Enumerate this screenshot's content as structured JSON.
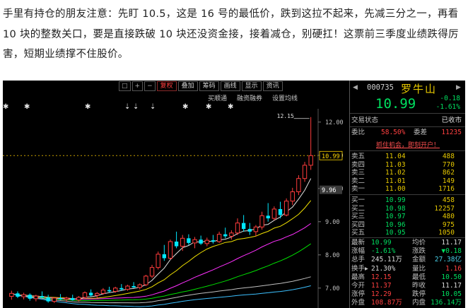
{
  "article": {
    "paragraph": "手里有持仓的朋友注意：先盯 10.5，这是 16 号的最低价，跌到这拉不起来，先减三分之一，再看 10 块的整数关口，要是直接跌破 10 块还没资金接，接着减仓，别硬扛！这票前三季度业绩跌得厉害，短期业绩撑不住股价。"
  },
  "toolbar": {
    "items": [
      "□",
      "+",
      "−",
      "复权",
      "叠加",
      "筹码",
      "画线",
      "显示",
      "资讯"
    ],
    "active_label": "复权",
    "sub_items": [
      "买顺通",
      "融资融券",
      "设置均线"
    ]
  },
  "chart_data": {
    "type": "candlestick",
    "y_axis": {
      "min": 6.4,
      "max": 12.4,
      "tick_labels": [
        "12.00",
        "11.00",
        "10.00",
        "9.00",
        "8.00",
        "7.00"
      ],
      "tick_values": [
        12,
        11,
        10,
        9,
        8,
        7
      ]
    },
    "current_price_tag": "10.99",
    "current_price": 10.99,
    "marker_price_tag": "9.96",
    "marker_price": 9.96,
    "high_label": "12.15",
    "high_value": 12.15,
    "candles": [
      [
        6.75,
        6.92,
        6.65,
        6.84
      ],
      [
        6.84,
        6.9,
        6.7,
        6.74
      ],
      [
        6.74,
        6.86,
        6.66,
        6.8
      ],
      [
        6.8,
        6.84,
        6.62,
        6.68
      ],
      [
        6.68,
        6.8,
        6.6,
        6.76
      ],
      [
        6.76,
        6.9,
        6.7,
        6.72
      ],
      [
        6.72,
        6.8,
        6.56,
        6.6
      ],
      [
        6.6,
        6.72,
        6.55,
        6.7
      ],
      [
        6.7,
        6.82,
        6.64,
        6.66
      ],
      [
        6.66,
        6.74,
        6.58,
        6.7
      ],
      [
        6.7,
        6.8,
        6.62,
        6.64
      ],
      [
        6.64,
        6.76,
        6.6,
        6.72
      ],
      [
        6.72,
        6.9,
        6.68,
        6.86
      ],
      [
        6.86,
        6.96,
        6.74,
        6.78
      ],
      [
        6.78,
        6.88,
        6.7,
        6.84
      ],
      [
        6.84,
        7.0,
        6.8,
        6.94
      ],
      [
        6.94,
        7.04,
        6.86,
        6.9
      ],
      [
        6.9,
        7.04,
        6.86,
        7.0
      ],
      [
        7.0,
        7.12,
        6.92,
        6.96
      ],
      [
        6.96,
        7.1,
        6.92,
        7.06
      ],
      [
        7.06,
        7.18,
        7.0,
        7.02
      ],
      [
        7.02,
        7.14,
        6.96,
        7.1
      ],
      [
        7.1,
        7.4,
        7.06,
        7.36
      ],
      [
        7.36,
        7.7,
        7.3,
        7.62
      ],
      [
        7.62,
        8.1,
        7.56,
        8.02
      ],
      [
        8.02,
        8.3,
        7.82,
        7.9
      ],
      [
        7.9,
        8.46,
        7.86,
        8.4
      ],
      [
        8.4,
        8.7,
        8.2,
        8.26
      ],
      [
        8.26,
        8.6,
        8.12,
        8.5
      ],
      [
        8.5,
        8.62,
        8.3,
        8.36
      ],
      [
        8.36,
        8.54,
        8.2,
        8.46
      ],
      [
        8.46,
        8.58,
        8.3,
        8.34
      ],
      [
        8.34,
        8.52,
        8.26,
        8.44
      ],
      [
        8.44,
        8.6,
        8.34,
        8.4
      ],
      [
        8.4,
        8.7,
        8.36,
        8.62
      ],
      [
        8.62,
        8.82,
        8.5,
        8.56
      ],
      [
        8.56,
        8.74,
        8.46,
        8.66
      ],
      [
        8.66,
        9.1,
        8.6,
        8.96
      ],
      [
        8.96,
        9.2,
        8.7,
        8.78
      ],
      [
        8.78,
        8.96,
        8.6,
        8.7
      ],
      [
        8.7,
        8.9,
        8.56,
        8.84
      ],
      [
        8.84,
        9.3,
        8.76,
        9.18
      ],
      [
        9.18,
        9.56,
        9.0,
        9.1
      ],
      [
        9.1,
        9.46,
        9.04,
        9.38
      ],
      [
        9.38,
        9.6,
        9.1,
        9.2
      ],
      [
        9.2,
        9.7,
        9.16,
        9.62
      ],
      [
        9.62,
        10.02,
        9.5,
        9.9
      ],
      [
        9.9,
        10.4,
        9.8,
        10.3
      ],
      [
        10.3,
        10.8,
        10.2,
        10.7
      ],
      [
        10.7,
        12.15,
        10.56,
        10.99
      ]
    ],
    "ma_colors": [
      "#e0e0e0",
      "#f0e000",
      "#ff30ff",
      "#00e000",
      "#c0c0c0",
      "#3cc0ff"
    ]
  },
  "panel": {
    "code": "000735",
    "name": "罗牛山",
    "price": "10.99",
    "change": "-0.18",
    "change_pct": "-1.61%",
    "status_label": "交易状态",
    "status_value": "已收市",
    "weibi_label": "委比",
    "weibi_value": "58.50%",
    "weicha_label": "委差",
    "weicha_value": "11235",
    "promo": "抓住机会，即刻开户！",
    "asks": [
      {
        "label": "卖五",
        "price": "11.04",
        "vol": "488"
      },
      {
        "label": "卖四",
        "price": "11.03",
        "vol": "770"
      },
      {
        "label": "卖三",
        "price": "11.02",
        "vol": "862"
      },
      {
        "label": "卖二",
        "price": "11.01",
        "vol": "149"
      },
      {
        "label": "卖一",
        "price": "11.00",
        "vol": "1716"
      }
    ],
    "bids": [
      {
        "label": "买一",
        "price": "10.99",
        "vol": "458"
      },
      {
        "label": "买二",
        "price": "10.98",
        "vol": "12257"
      },
      {
        "label": "买三",
        "price": "10.97",
        "vol": "480"
      },
      {
        "label": "买四",
        "price": "10.96",
        "vol": "975"
      },
      {
        "label": "买五",
        "price": "10.95",
        "vol": "1050"
      }
    ],
    "stats": [
      {
        "l1": "最新",
        "v1": "10.99",
        "c1": "g",
        "l2": "均价",
        "v2": "11.17",
        "c2": "w"
      },
      {
        "l1": "涨幅",
        "v1": "-1.61%",
        "c1": "g",
        "l2": "涨跌",
        "v2": "▼0.18",
        "c2": "g"
      },
      {
        "l1": "总手",
        "v1": "245.11万",
        "c1": "w",
        "l2": "金额",
        "v2": "27.38亿",
        "c2": "c"
      },
      {
        "l1": "换手▸",
        "v1": "21.30%",
        "c1": "w",
        "l2": "量比",
        "v2": "1.16",
        "c2": "r"
      },
      {
        "l1": "最高",
        "v1": "12.15",
        "c1": "r",
        "l2": "最低",
        "v2": "10.50",
        "c2": "g"
      },
      {
        "l1": "今开",
        "v1": "11.37",
        "c1": "r",
        "l2": "昨收",
        "v2": "11.17",
        "c2": "w"
      },
      {
        "l1": "涨停",
        "v1": "12.29",
        "c1": "r",
        "l2": "跌停",
        "v2": "10.05",
        "c2": "g"
      },
      {
        "l1": "外盘",
        "v1": "108.87万",
        "c1": "r",
        "l2": "内盘",
        "v2": "136.14万",
        "c2": "g"
      }
    ]
  }
}
